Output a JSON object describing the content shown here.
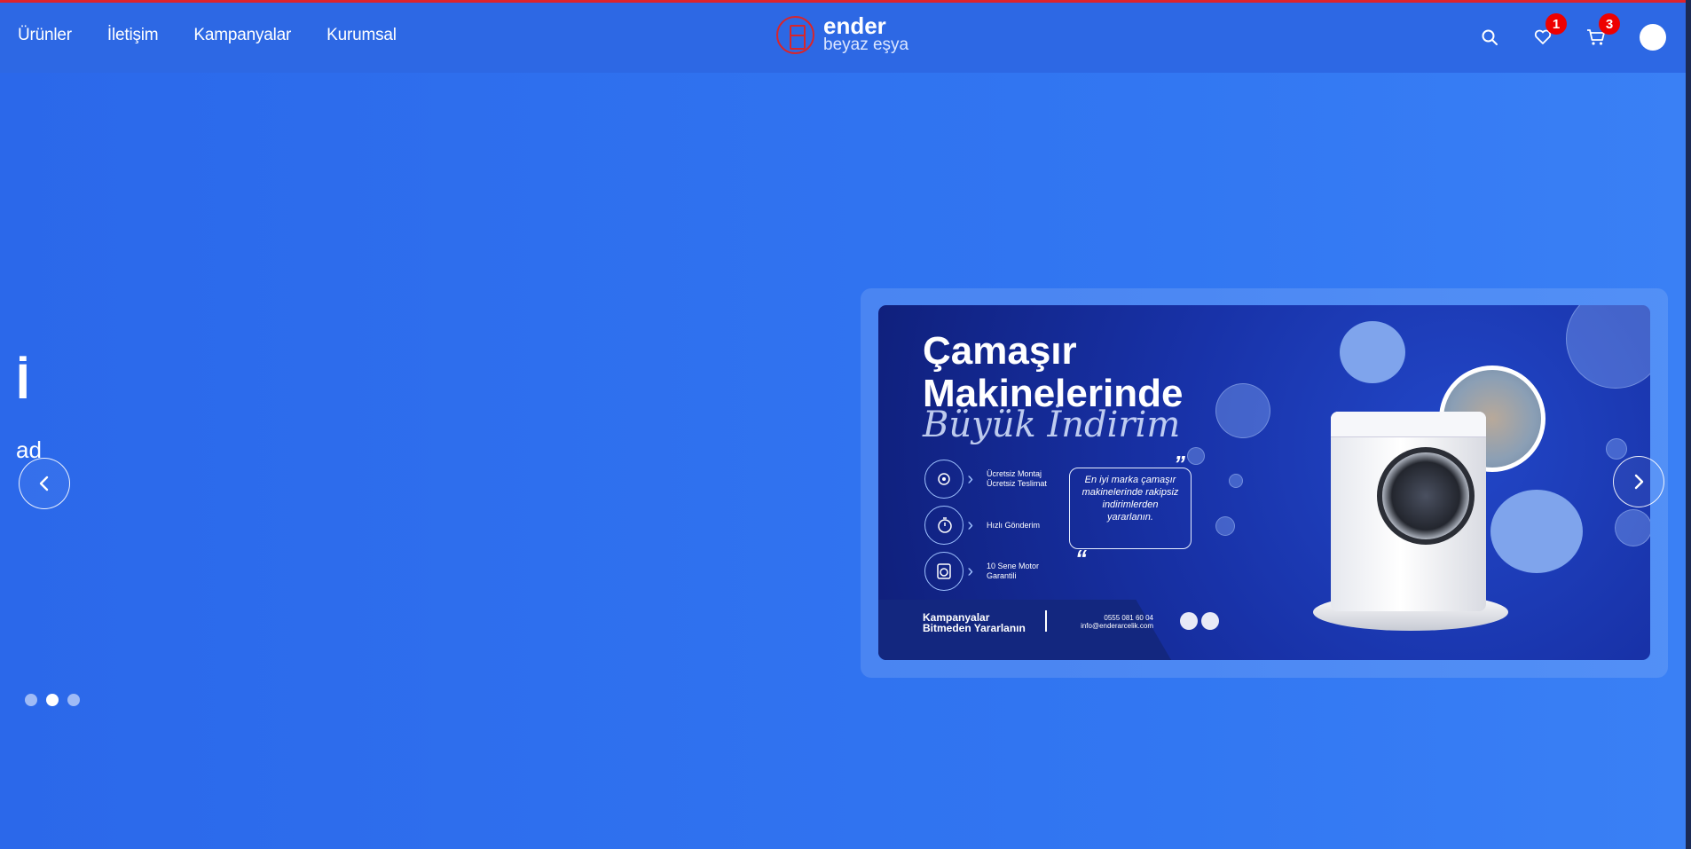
{
  "nav": {
    "items": [
      "Ürünler",
      "İletişim",
      "Kampanyalar",
      "Kurumsal"
    ]
  },
  "logo": {
    "name": "ender",
    "subtitle": "beyaz eşya",
    "color": "#d9252a"
  },
  "header_icons": {
    "search": "search-icon",
    "wishlist": "heart-icon",
    "wishlist_count": "1",
    "cart": "cart-icon",
    "cart_count": "3",
    "user": "avatar"
  },
  "slider": {
    "partial_title": "İ",
    "partial_text": "ad",
    "dots": 3,
    "active_dot": 1
  },
  "banner": {
    "title_line1": "Çamaşır",
    "title_line2": "Makinelerinde",
    "script": "Büyük İndirim",
    "features": [
      {
        "line1": "Ücretsiz Montaj",
        "line2": "Ücretsiz Teslimat",
        "icon": "gear-icon"
      },
      {
        "line1": "Hızlı Gönderim",
        "line2": "",
        "icon": "stopwatch-icon"
      },
      {
        "line1": "10 Sene Motor",
        "line2": "Garantili",
        "icon": "washer-icon"
      }
    ],
    "quote": "En iyi marka çamaşır makinelerinde rakipsiz indirimlerden yararlanın.",
    "footer_line1": "Kampanyalar",
    "footer_line2": "Bitmeden Yararlanın",
    "phone": "0555 081 60 04",
    "email": "info@enderarcelik.com"
  },
  "colors": {
    "background": "#2f6ff0",
    "header": "#2d68e4",
    "badge": "#e00000",
    "banner_dark": "#0f1f7a"
  }
}
